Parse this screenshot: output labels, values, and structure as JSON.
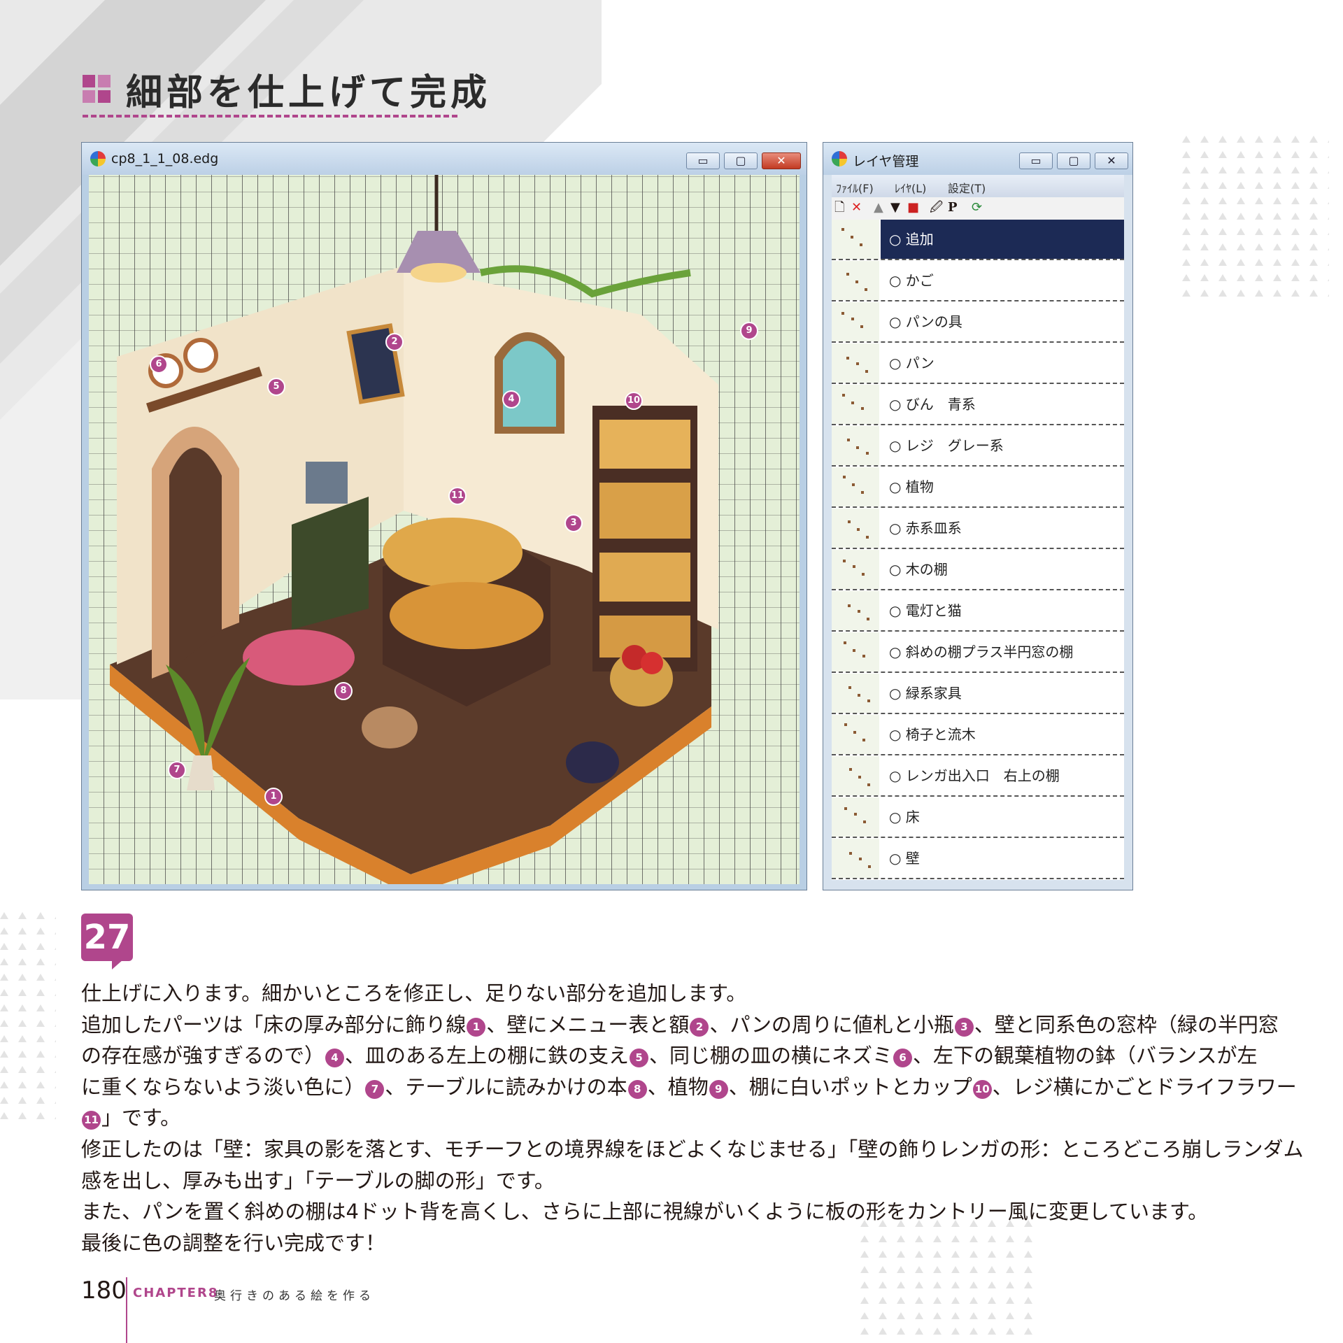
{
  "heading": {
    "title": "細部を仕上げて完成",
    "square_colors": [
      "#b0468c",
      "#c87db0",
      "#c87db0",
      "#b0468c"
    ]
  },
  "editor_window": {
    "title": "cp8_1_1_08.edg",
    "buttons": {
      "minimize": "▭",
      "maximize": "▢",
      "close": "✕"
    }
  },
  "canvas_badges": [
    "1",
    "2",
    "3",
    "4",
    "5",
    "6",
    "7",
    "8",
    "9",
    "10",
    "11"
  ],
  "layer_window": {
    "title": "レイヤ管理",
    "buttons": {
      "minimize": "▭",
      "maximize": "▢",
      "close": "✕"
    },
    "menu": [
      "ﾌｧｲﾙ(F)",
      "ﾚｲﾔ(L)",
      "設定(T)"
    ],
    "tools": {
      "new": "🗋",
      "delete": "✕",
      "up": "▲",
      "down": "▼",
      "color": "■",
      "edit": "🖉",
      "p": "P",
      "refresh": "⟳"
    },
    "layers": [
      {
        "name": "○ 追加",
        "selected": true
      },
      {
        "name": "○ かご"
      },
      {
        "name": "○ パンの具"
      },
      {
        "name": "○ パン"
      },
      {
        "name": "○ びん　青系"
      },
      {
        "name": "○ レジ　グレー系"
      },
      {
        "name": "○ 植物"
      },
      {
        "name": "○ 赤系皿系"
      },
      {
        "name": "○ 木の棚"
      },
      {
        "name": "○ 電灯と猫"
      },
      {
        "name": "○ 斜めの棚プラス半円窓の棚"
      },
      {
        "name": "○ 緑系家具"
      },
      {
        "name": "○ 椅子と流木"
      },
      {
        "name": "○ レンガ出入口　右上の棚"
      },
      {
        "name": "○ 床"
      },
      {
        "name": "○ 壁"
      }
    ]
  },
  "step": {
    "number": "27"
  },
  "body": {
    "p1": "仕上げに入ります。細かいところを修正し、足りない部分を追加します。",
    "p2a": "追加したパーツは「床の厚み部分に飾り線",
    "p2b": "、壁にメニュー表と額",
    "p2c": "、パンの周りに値札と小瓶",
    "p2d": "、壁と同系色の窓枠（緑の半円窓",
    "p3a": "の存在感が強すぎるので）",
    "p3b": "、皿のある左上の棚に鉄の支え",
    "p3c": "、同じ棚の皿の横にネズミ",
    "p3d": "、左下の観葉植物の鉢（バランスが左",
    "p4a": "に重くならないよう淡い色に）",
    "p4b": "、テーブルに読みかけの本",
    "p4c": "、植物",
    "p4d": "、棚に白いポットとカップ",
    "p4e": "、レジ横にかごとドライフラワー",
    "p5a": "」です。",
    "p6": "修正したのは「壁：家具の影を落とす、モチーフとの境界線をほどよくなじませる」「壁の飾りレンガの形：ところどころ崩しランダム",
    "p7": "感を出し、厚みも出す」「テーブルの脚の形」です。",
    "p8": "また、パンを置く斜めの棚は4ドット背を高くし、さらに上部に視線がいくように板の形をカントリー風に変更しています。",
    "p9": "最後に色の調整を行い完成です！",
    "n1": "1",
    "n2": "2",
    "n3": "3",
    "n4": "4",
    "n5": "5",
    "n6": "6",
    "n7": "7",
    "n8": "8",
    "n9": "9",
    "n10": "10",
    "n11": "11"
  },
  "footer": {
    "page": "180",
    "chapter": "CHAPTER8",
    "chapter_title": "奥行きのある絵を作る"
  },
  "colors": {
    "accent": "#b0468c",
    "selected_layer": "#1c2a55",
    "canvas_bg": "#e4efd7"
  }
}
